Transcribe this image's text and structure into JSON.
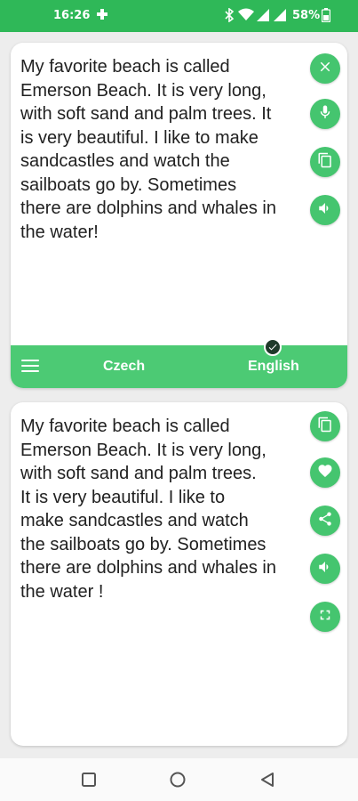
{
  "status_bar": {
    "time": "16:26",
    "battery": "58%",
    "icons": [
      "app-notification-icon",
      "bluetooth-icon",
      "wifi-icon",
      "signal-icon",
      "signal-icon",
      "battery-icon"
    ]
  },
  "colors": {
    "status_bar": "#2fb858",
    "accent": "#45c56f",
    "lang_bar": "#4cca74"
  },
  "source_panel": {
    "text": "My favorite beach is called\nEmerson Beach. It is very long,\nwith soft sand and palm trees. It\nis very beautiful. I like to make\nsandcastles and watch the\nsailboats go by. Sometimes\nthere are dolphins and whales in\nthe water!",
    "actions": [
      "close-icon",
      "microphone-icon",
      "copy-icon",
      "speaker-icon"
    ]
  },
  "language_bar": {
    "source_language": "Czech",
    "target_language": "English"
  },
  "target_panel": {
    "text": "My favorite beach is called\nEmerson Beach. It is very long,\nwith soft sand and palm trees.\nIt is very beautiful. I like to\nmake sandcastles and watch\nthe sailboats go by. Sometimes\nthere are dolphins and whales in\nthe water !",
    "actions": [
      "copy-icon",
      "heart-icon",
      "share-icon",
      "speaker-icon",
      "fullscreen-icon"
    ]
  },
  "nav_bar": {
    "buttons": [
      "recents-icon",
      "home-icon",
      "back-icon"
    ]
  }
}
